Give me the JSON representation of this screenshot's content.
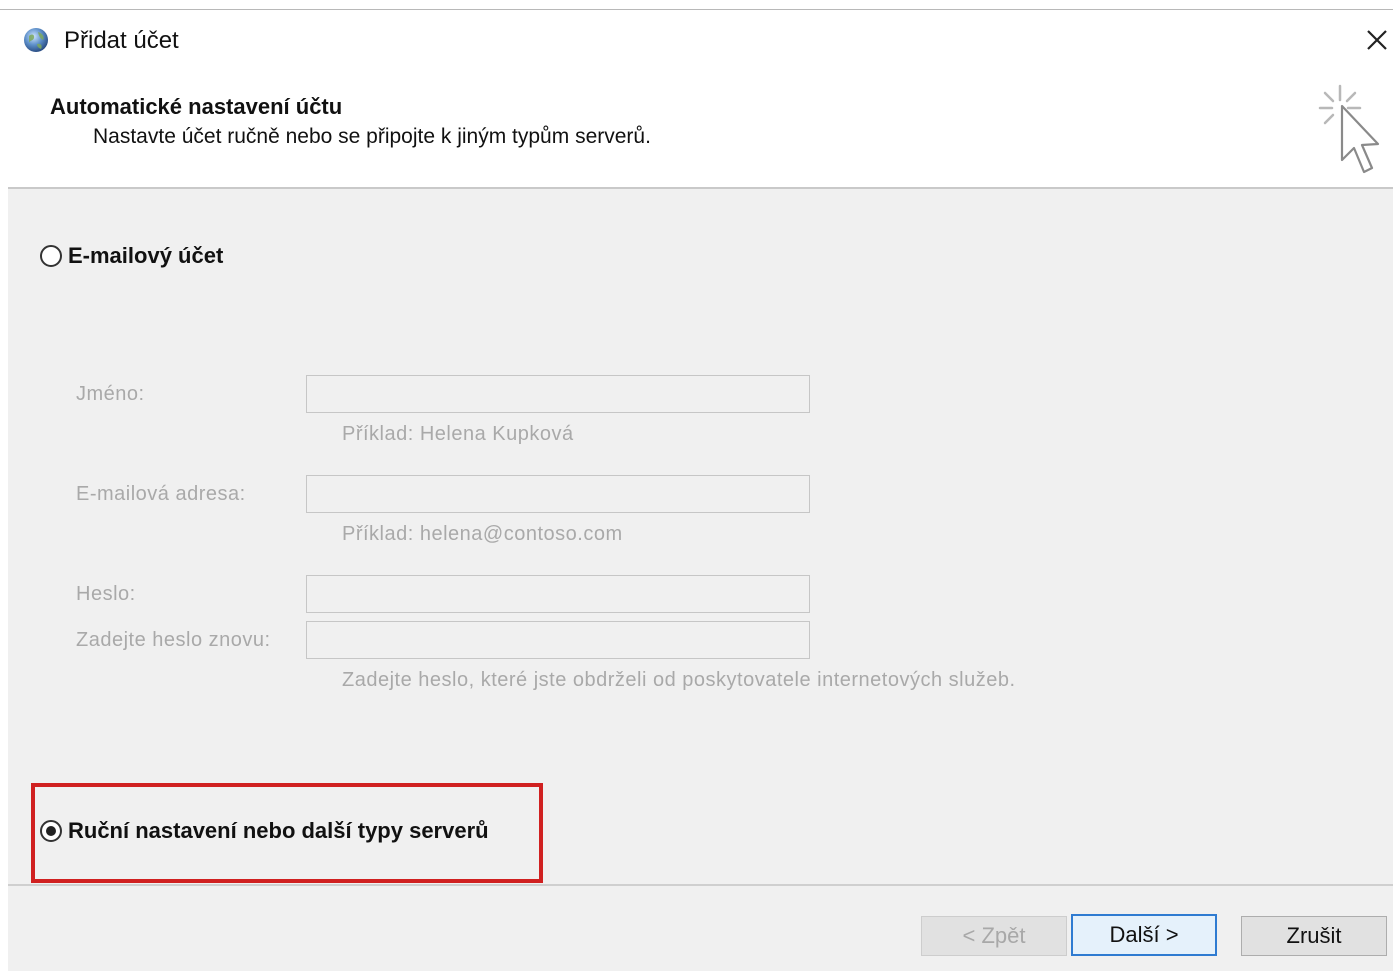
{
  "window": {
    "title": "Přidat účet",
    "close_icon": "close-icon",
    "app_icon": "globe-icon"
  },
  "header": {
    "title": "Automatické nastavení účtu",
    "subtitle": "Nastavte účet ručně nebo se připojte k jiným typům serverů.",
    "icon": "cursor-click-icon"
  },
  "options": {
    "email_account": {
      "label": "E-mailový účet",
      "selected": false
    },
    "manual_setup": {
      "label": "Ruční nastavení nebo další typy serverů",
      "selected": true
    }
  },
  "form": {
    "name": {
      "label": "Jméno:",
      "value": "",
      "hint": "Příklad: Helena Kupková"
    },
    "email": {
      "label": "E-mailová adresa:",
      "value": "",
      "hint": "Příklad: helena@contoso.com"
    },
    "password": {
      "label": "Heslo:",
      "value": ""
    },
    "password_confirm": {
      "label": "Zadejte heslo znovu:",
      "value": "",
      "hint": "Zadejte heslo, které jste obdrželi od poskytovatele internetových služeb."
    },
    "disabled": true
  },
  "buttons": {
    "back": "< Zpět",
    "next": "Další >",
    "cancel": "Zrušit"
  },
  "colors": {
    "highlight": "#d02020",
    "default_button_border": "#2f7bd1",
    "disabled_text": "#a9a9a9"
  }
}
